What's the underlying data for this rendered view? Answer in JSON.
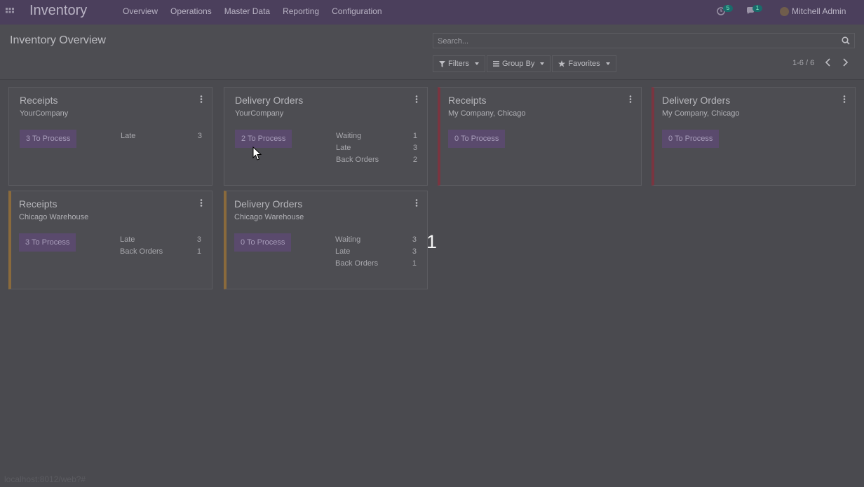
{
  "navbar": {
    "app_title": "Inventory",
    "menu": [
      "Overview",
      "Operations",
      "Master Data",
      "Reporting",
      "Configuration"
    ],
    "activity_count": "5",
    "message_count": "1",
    "user_name": "Mitchell Admin",
    "bg_color": "#4b3f5c"
  },
  "control_panel": {
    "title": "Inventory Overview",
    "search_placeholder": "Search...",
    "filters_label": "Filters",
    "group_by_label": "Group By",
    "favorites_label": "Favorites",
    "pager": "1-6 / 6"
  },
  "cards": [
    {
      "title": "Receipts",
      "subtitle": "YourCompany",
      "button": "3 To Process",
      "stats": [
        {
          "label": "Late",
          "value": "3"
        }
      ]
    },
    {
      "title": "Delivery Orders",
      "subtitle": "YourCompany",
      "button": "2 To Process",
      "stats": [
        {
          "label": "Waiting",
          "value": "1"
        },
        {
          "label": "Late",
          "value": "3"
        },
        {
          "label": "Back Orders",
          "value": "2"
        }
      ]
    },
    {
      "title": "Receipts",
      "subtitle": "My Company, Chicago",
      "button": "0 To Process",
      "stats": []
    },
    {
      "title": "Delivery Orders",
      "subtitle": "My Company, Chicago",
      "button": "0 To Process",
      "stats": []
    },
    {
      "title": "Receipts",
      "subtitle": "Chicago Warehouse",
      "button": "3 To Process",
      "stats": [
        {
          "label": "Late",
          "value": "3"
        },
        {
          "label": "Back Orders",
          "value": "1"
        }
      ]
    },
    {
      "title": "Delivery Orders",
      "subtitle": "Chicago Warehouse",
      "button": "0 To Process",
      "stats": [
        {
          "label": "Waiting",
          "value": "3"
        },
        {
          "label": "Late",
          "value": "3"
        },
        {
          "label": "Back Orders",
          "value": "1"
        }
      ]
    }
  ],
  "overlay_number": "1",
  "status_url": "localhost:8012/web?#"
}
